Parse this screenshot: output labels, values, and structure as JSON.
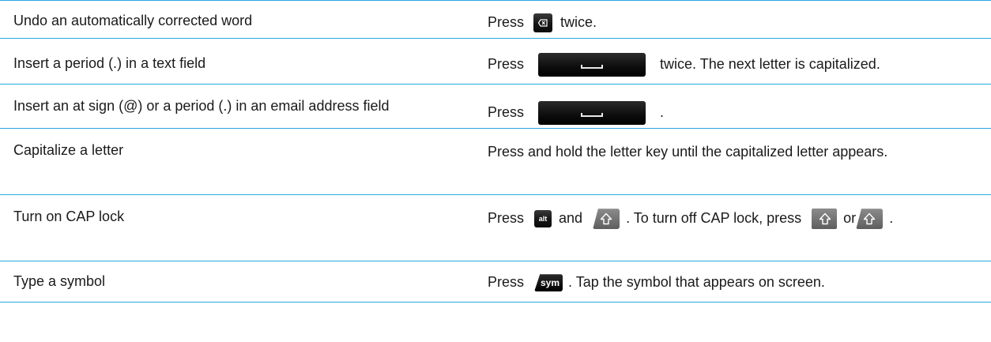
{
  "rows": [
    {
      "action": "Undo an automatically corrected word",
      "how": {
        "before": "Press",
        "after": "twice."
      },
      "key_icon": "backspace-key-icon"
    },
    {
      "action": "Insert a period (.) in a text field",
      "how": {
        "before": "Press",
        "after": "twice. The next letter is capitalized."
      },
      "key_icon": "space-key-icon"
    },
    {
      "action": "Insert an at sign (@) or a period (.) in an email address field",
      "how": {
        "before": "Press",
        "after": "."
      },
      "key_icon": "space-key-icon"
    },
    {
      "action": "Capitalize a letter",
      "how": {
        "text": "Press and hold the letter key until the capitalized letter appears."
      }
    },
    {
      "action": "Turn on CAP lock",
      "how": {
        "part1": "Press",
        "part2": "and",
        "part3": ". To turn off CAP lock, press",
        "part4": "or",
        "part5": "."
      },
      "alt_key_label": "alt",
      "key_icons": [
        "alt-key-icon",
        "shift-key-icon"
      ]
    },
    {
      "action": "Type a symbol",
      "how": {
        "before": "Press",
        "after": ". Tap the symbol that appears on screen."
      },
      "sym_key_label": "sym"
    }
  ],
  "colors": {
    "divider": "#29a8e0",
    "text": "#1a1a1a",
    "key_dark": "#151515",
    "key_shift": "#6e6e6e"
  }
}
